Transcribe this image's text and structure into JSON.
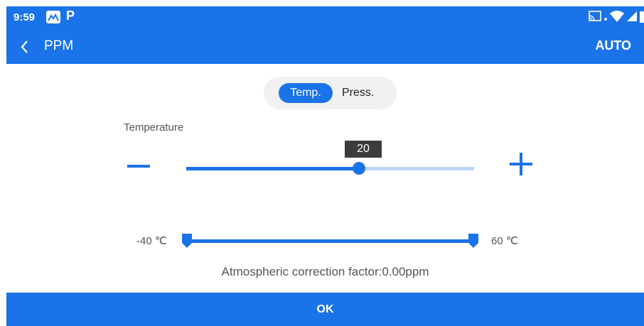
{
  "status_bar": {
    "time": "9:59",
    "app_icons": [
      "maps-icon",
      "parking-icon"
    ],
    "parking_glyph": "P",
    "right_icons": [
      "cast-icon",
      "wifi-icon",
      "signal-icon",
      "battery-icon"
    ]
  },
  "app_bar": {
    "title": "PPM",
    "action_label": "AUTO",
    "back_icon": "chevron-left-icon"
  },
  "mode_toggle": {
    "options": [
      "Temp.",
      "Press."
    ],
    "selected": "Temp."
  },
  "temperature": {
    "label": "Temperature",
    "value": "20",
    "value_fraction": 0.6,
    "minus_icon": "minus-icon",
    "plus_icon": "plus-icon"
  },
  "range": {
    "min_label": "-40 ℃",
    "max_label": "60 ℃"
  },
  "correction_text": "Atmospheric correction factor:0.00ppm",
  "ok_label": "OK",
  "colors": {
    "primary": "#1a73e8",
    "track_light": "#bcd8f5",
    "tooltip_bg": "#3c3c3c"
  }
}
